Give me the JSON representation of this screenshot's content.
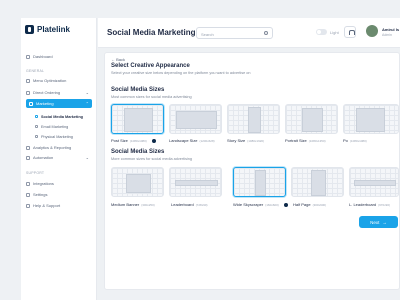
{
  "brand": {
    "name": "Platelink"
  },
  "sidebar": {
    "items_top": [
      {
        "label": "Dashboard"
      }
    ],
    "section_general": "GENERAL",
    "items_general": [
      {
        "label": "Menu Optimization"
      },
      {
        "label": "Direct Ordering"
      },
      {
        "label": "Marketing"
      }
    ],
    "sub_items": [
      {
        "label": "Social Media Marketing"
      },
      {
        "label": "Email Marketing"
      },
      {
        "label": "Physical Marketing"
      }
    ],
    "items_after": [
      {
        "label": "Analytics & Reporting"
      },
      {
        "label": "Automation"
      }
    ],
    "section_support": "SUPPORT",
    "items_support": [
      {
        "label": "Integrations"
      },
      {
        "label": "Settings"
      },
      {
        "label": "Help & Support"
      }
    ],
    "accent_color": "#1aa3e8"
  },
  "header": {
    "title": "Social Media Marketing",
    "search_placeholder": "Search",
    "theme_label": "Light",
    "user_name": "Amirul Is",
    "user_role": "Admin"
  },
  "panel": {
    "back_label": "Back",
    "title": "Select Creative Appearance",
    "subtitle": "Select your creative size below depending on the platform you want to advertise on",
    "section1": {
      "title": "Social Media Sizes",
      "subtitle": "Most common sizes for social media advertising",
      "cards": [
        {
          "label": "Post Size",
          "dim": "(1080x1080)",
          "selected": true
        },
        {
          "label": "Landscape Size",
          "dim": "(1200x628)",
          "selected": false
        },
        {
          "label": "Story Size",
          "dim": "(1080x1920)",
          "selected": false
        },
        {
          "label": "Portrait Size",
          "dim": "(1080x1350)",
          "selected": false
        },
        {
          "label": "Po",
          "dim": "(1080x1080)",
          "selected": false
        }
      ]
    },
    "section2": {
      "title": "Social Media Sizes",
      "subtitle": "More common sizes for social media advertising",
      "cards": [
        {
          "label": "Medium Banner",
          "dim": "(300x250)",
          "selected": false
        },
        {
          "label": "Leaderboard",
          "dim": "(728x90)",
          "selected": false
        },
        {
          "label": "Wide Skyscraper",
          "dim": "(160x600)",
          "selected": true
        },
        {
          "label": "Half Page",
          "dim": "(300x600)",
          "selected": false
        },
        {
          "label": "L. Leaderboard",
          "dim": "(970x90)",
          "selected": false
        }
      ]
    },
    "next_label": "Next",
    "next_arrow": "→"
  }
}
